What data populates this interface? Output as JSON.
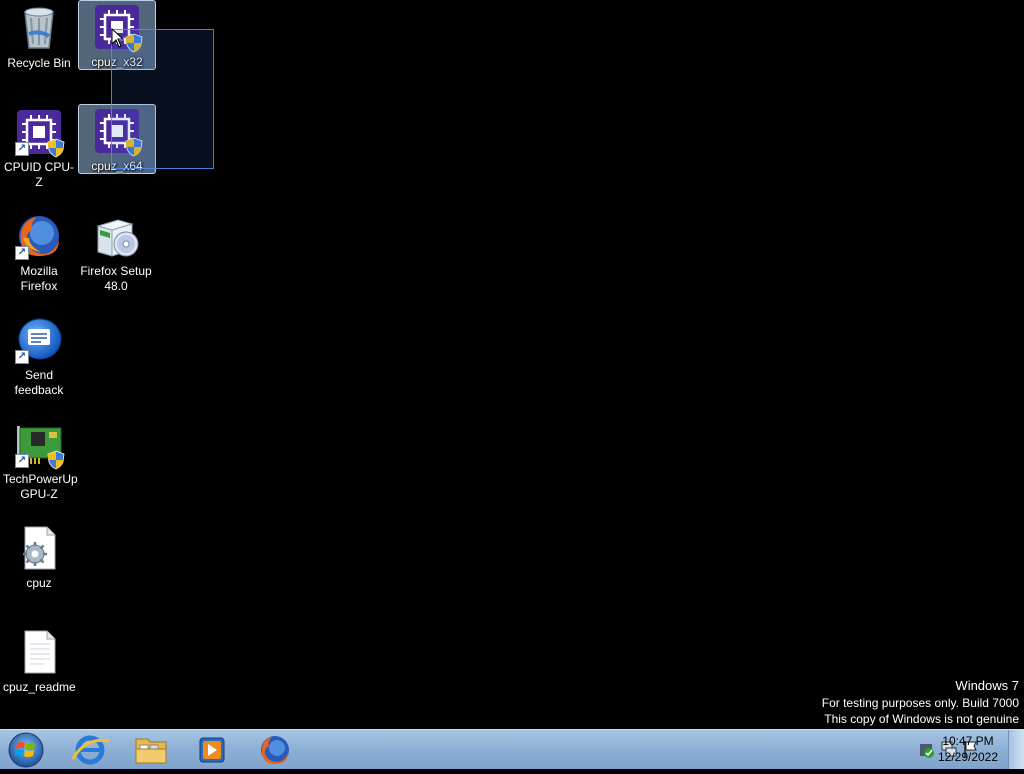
{
  "desktop": {
    "icons": [
      {
        "label": "Recycle Bin"
      },
      {
        "label": "cpuz_x32"
      },
      {
        "label": "CPUID CPU-Z"
      },
      {
        "label": "cpuz_x64"
      },
      {
        "label": "Mozilla Firefox"
      },
      {
        "label": "Firefox Setup 48.0"
      },
      {
        "label": "Send feedback"
      },
      {
        "label": "TechPowerUp GPU-Z"
      },
      {
        "label": "cpuz"
      },
      {
        "label": "cpuz_readme"
      }
    ]
  },
  "watermark": {
    "line1": "Windows  7",
    "line2": "For testing purposes only. Build 7000",
    "line3": "This copy of Windows is not genuine"
  },
  "taskbar": {
    "apps": [
      {
        "icon": "internet-explorer-icon"
      },
      {
        "icon": "windows-explorer-icon"
      },
      {
        "icon": "media-player-icon"
      },
      {
        "icon": "firefox-icon"
      }
    ],
    "clock": {
      "time": "10:47 PM",
      "date": "12/29/2022"
    }
  },
  "colors": {
    "taskbar": "#8fb1d6",
    "selection": "#99b9e0",
    "desktop": "#000000"
  }
}
